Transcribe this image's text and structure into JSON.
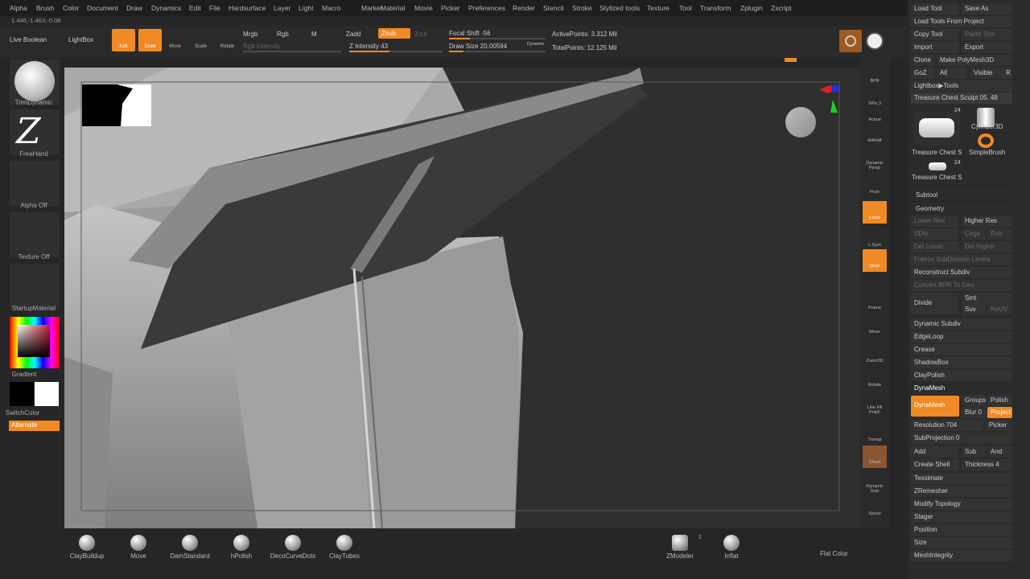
{
  "menu": [
    "Alpha",
    "Brush",
    "Color",
    "Document",
    "Draw",
    "Dynamics",
    "Edit",
    "File",
    "Hardsurface",
    "Layer",
    "Light",
    "Macro",
    "Marker",
    "Material",
    "Movie",
    "Picker",
    "Preferences",
    "Render",
    "Stencil",
    "Stroke",
    "Stylized tools",
    "Texture",
    "Tool",
    "Transform",
    "Zplugin",
    "Zscript"
  ],
  "coords": "1.446,-1.463,-0.08",
  "toolbar": {
    "live_boolean": "Live Boolean",
    "lightbox": "LightBox",
    "edit": "Edit",
    "draw": "Draw",
    "move": "Move",
    "scale": "Scale",
    "rotate": "Rotate",
    "mrgb": "Mrgb",
    "rgb": "Rgb",
    "m": "M",
    "rgb_intensity": "Rgb Intensity",
    "zadd": "Zadd",
    "zsub": "Zsub",
    "zcut": "Zcut",
    "z_intensity": "Z Intensity 43",
    "focal_shift": "Focal Shift -56",
    "draw_size": "Draw Size 20.00594",
    "dynamic": "Dynamic",
    "active_points": "ActivePoints: 3.312 Mil",
    "total_points": "TotalPoints: 12.125 Mil"
  },
  "left": {
    "trim_dynamic": "TrimDynamic",
    "freehand": "FreeHand",
    "alpha_off": "Alpha Off",
    "texture_off": "Texture Off",
    "startup_material": "StartupMaterial",
    "gradient": "Gradient",
    "switch_color": "SwitchColor",
    "alternate": "Alternate"
  },
  "rightstrip": [
    "BPR",
    "SPix 3",
    "Actual",
    "AAHalf",
    "Dynamic Persp",
    "Floor",
    "Local",
    "L.Sym",
    "Qxyz",
    "Frame",
    "Move",
    "Zoom3D",
    "Rotate",
    "Line Fill PolyF",
    "Transp",
    "Ghost",
    "Dynamic Solo",
    "Xpose"
  ],
  "tool": {
    "load_tool": "Load Tool",
    "save_as": "Save As",
    "load_from_project": "Load Tools From Project",
    "copy_tool": "Copy Tool",
    "paste_tool": "Paste Tool",
    "import": "Import",
    "export": "Export",
    "clone": "Clone",
    "make_polymesh": "Make PolyMesh3D",
    "goz": "GoZ",
    "all": "All",
    "visible": "Visible",
    "r": "R",
    "lightbox_tools": "Lightbox▶Tools",
    "current": "Treasure Chest Sculpt 05. 48",
    "thumb1": "Treasure Chest S",
    "thumb1_count": "24",
    "thumb2": "Cylinder3D",
    "thumb3": "SimpleBrush",
    "thumb4": "Treasure Chest S",
    "thumb4_count": "24"
  },
  "subtool": "Subtool",
  "geometry": {
    "title": "Geometry",
    "lower_res": "Lower Res",
    "higher_res": "Higher Res",
    "sdiv": "SDiv",
    "cage": "Cage",
    "rstr": "Rstr",
    "del_lower": "Del Lower",
    "del_higher": "Del Higher",
    "freeze": "Freeze SubDivision Levels",
    "reconstruct": "Reconstruct Subdiv",
    "convert_bpr": "Convert BPR To Geo",
    "divide": "Divide",
    "smt": "Smt",
    "suv": "Suv",
    "reuv": "ReUV",
    "dynamic_subdiv": "Dynamic Subdiv",
    "edgeloop": "EdgeLoop",
    "crease": "Crease",
    "shadowbox": "ShadowBox",
    "claypolish": "ClayPolish",
    "dynamesh_title": "DynaMesh",
    "dynamesh": "DynaMesh",
    "groups": "Groups",
    "polish": "Polish",
    "blur": "Blur 0",
    "project": "Project",
    "resolution": "Resolution 704",
    "picker": "Picker",
    "subprojection": "SubProjection 0",
    "add": "Add",
    "sub": "Sub",
    "and": "And",
    "create_shell": "Create Shell",
    "thickness": "Thickness 4",
    "tessimate": "Tessimate",
    "zremesher": "ZRemesher",
    "modify_topology": "Modify Topology",
    "stager": "Stager",
    "position": "Position",
    "size": "Size",
    "meshintegrity": "MeshIntegrity"
  },
  "brushes": [
    "ClayBuildup",
    "Move",
    "DamStandard",
    "hPolish",
    "DecoCurveDots",
    "ClayTubes"
  ],
  "zmodeler": "ZModeler",
  "zmodeler_count": "1",
  "inflat": "Inflat",
  "flat_color": "Flat Color",
  "colors": {
    "accent": "#f08a24"
  }
}
